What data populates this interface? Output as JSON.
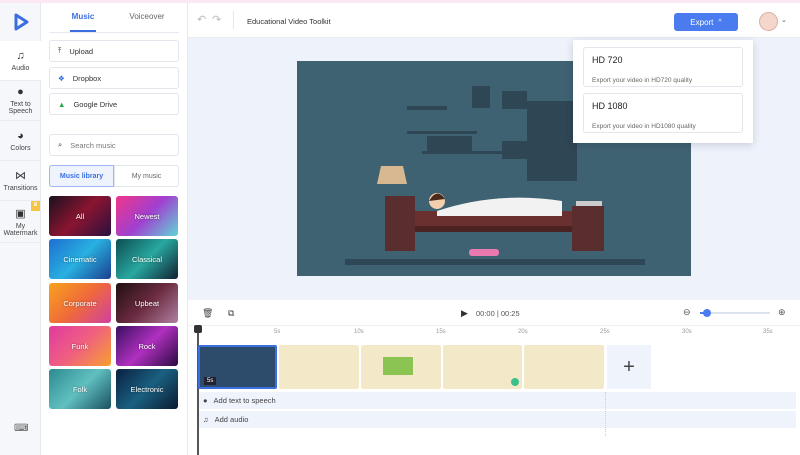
{
  "app": {
    "project_title": "Educational Video Toolkit",
    "accent": "#4a7cf0"
  },
  "rail": {
    "items": [
      {
        "label": "Audio",
        "icon": "music-note-icon"
      },
      {
        "label": "Text to Speech",
        "icon": "speech-icon"
      },
      {
        "label": "Colors",
        "icon": "palette-icon"
      },
      {
        "label": "Transitions",
        "icon": "bowtie-icon"
      },
      {
        "label": "My Watermark",
        "icon": "watermark-icon"
      }
    ]
  },
  "panel": {
    "tabs": [
      "Music",
      "Voiceover"
    ],
    "sources": [
      "Upload",
      "Dropbox",
      "Google Drive"
    ],
    "search_placeholder": "Search music",
    "segments": [
      "Music library",
      "My music"
    ],
    "genres": [
      "All",
      "Newest",
      "Cinematic",
      "Classical",
      "Corporate",
      "Upbeat",
      "Funk",
      "Rock",
      "Folk",
      "Electronic"
    ]
  },
  "export": {
    "label": "Export",
    "options": [
      {
        "title": "HD 720",
        "desc": "Export your video in HD720 quality"
      },
      {
        "title": "HD 1080",
        "desc": "Export your video in HD1080 quality"
      }
    ]
  },
  "timeline": {
    "time": "00:00 | 00:25",
    "zoom_level": 0.1,
    "ruler": [
      "5s",
      "10s",
      "15s",
      "20s",
      "25s",
      "30s",
      "35s"
    ],
    "first_clip_duration": "5s",
    "tts_label": "Add text to speech",
    "audio_label": "Add audio"
  }
}
